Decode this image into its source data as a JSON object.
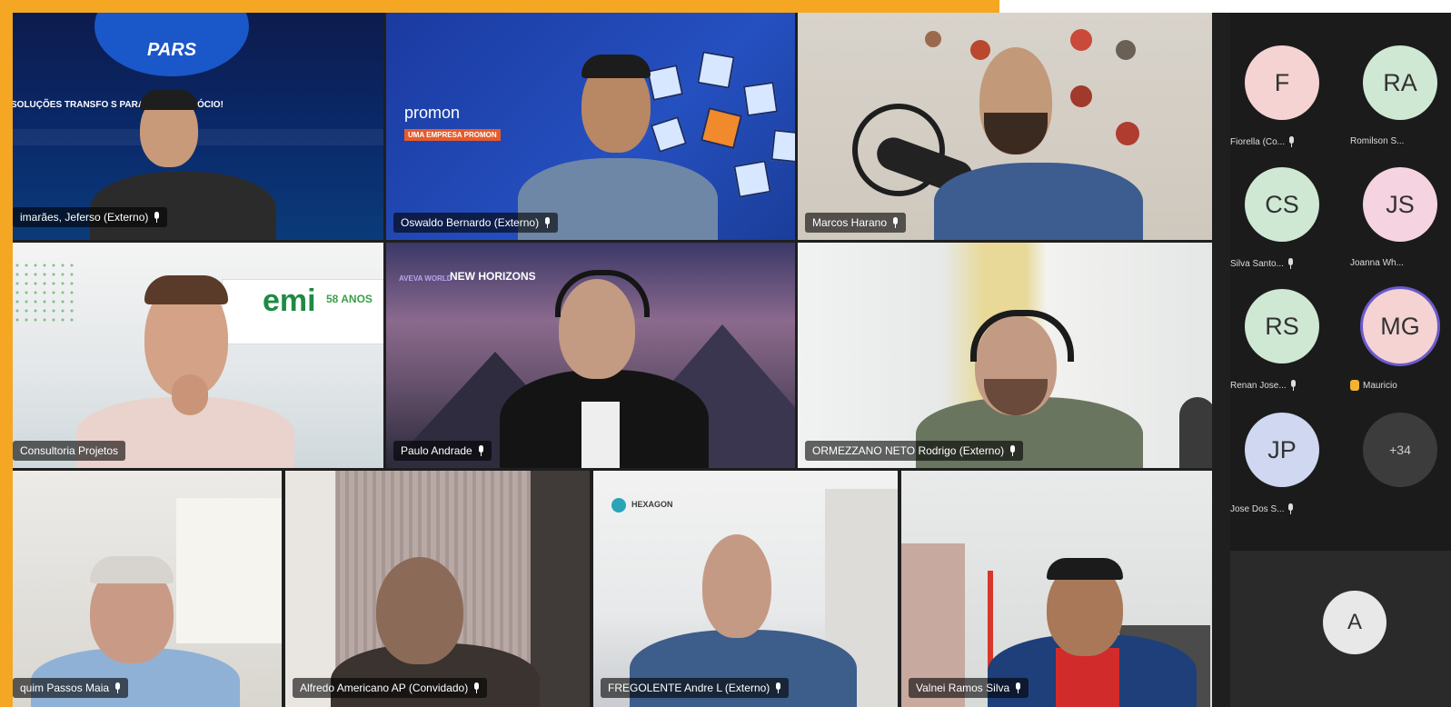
{
  "tiles": [
    {
      "name": "imarães, Jeferso (Externo)",
      "banner": "SOLUÇÕES TRANSFO   S PARA O SEU NEGÓCIO!",
      "logo": "PARS"
    },
    {
      "name": "Oswaldo Bernardo (Externo)",
      "logo": "promon",
      "tagline": "UMA EMPRESA PROMON"
    },
    {
      "name": "Marcos Harano"
    },
    {
      "name": "Consultoria Projetos",
      "logo": "emi",
      "badge": "58 ANOS"
    },
    {
      "name": "Paulo Andrade",
      "logo": "AVEVA WORLD",
      "logo2": "NEW HORIZONS"
    },
    {
      "name": "ORMEZZANO NETO Rodrigo (Externo)"
    },
    {
      "name": "quim Passos Maia"
    },
    {
      "name": "Alfredo Americano AP (Convidado)"
    },
    {
      "name": "FREGOLENTE Andre L (Externo)",
      "logo": "HEXAGON"
    },
    {
      "name": "Valnei Ramos Silva"
    }
  ],
  "sidebar": {
    "participants": [
      {
        "initials": "F",
        "label": "Fiorella (Co...",
        "color": "#f5d3d3"
      },
      {
        "initials": "RA",
        "label": "Romilson S...",
        "color": "#cfe8d4"
      },
      {
        "initials": "CS",
        "label": "Silva Santo...",
        "color": "#cfe8d4"
      },
      {
        "initials": "JS",
        "label": "Joanna Wh...",
        "color": "#f5d3e0"
      },
      {
        "initials": "RS",
        "label": "Renan Jose...",
        "color": "#cfe8d4"
      },
      {
        "initials": "MG",
        "label": "Mauricio",
        "color": "#f5d3d3",
        "hand": true
      },
      {
        "initials": "JP",
        "label": "Jose Dos S...",
        "color": "#cfd8f0"
      }
    ],
    "more": "+34",
    "self_initial": "A"
  }
}
